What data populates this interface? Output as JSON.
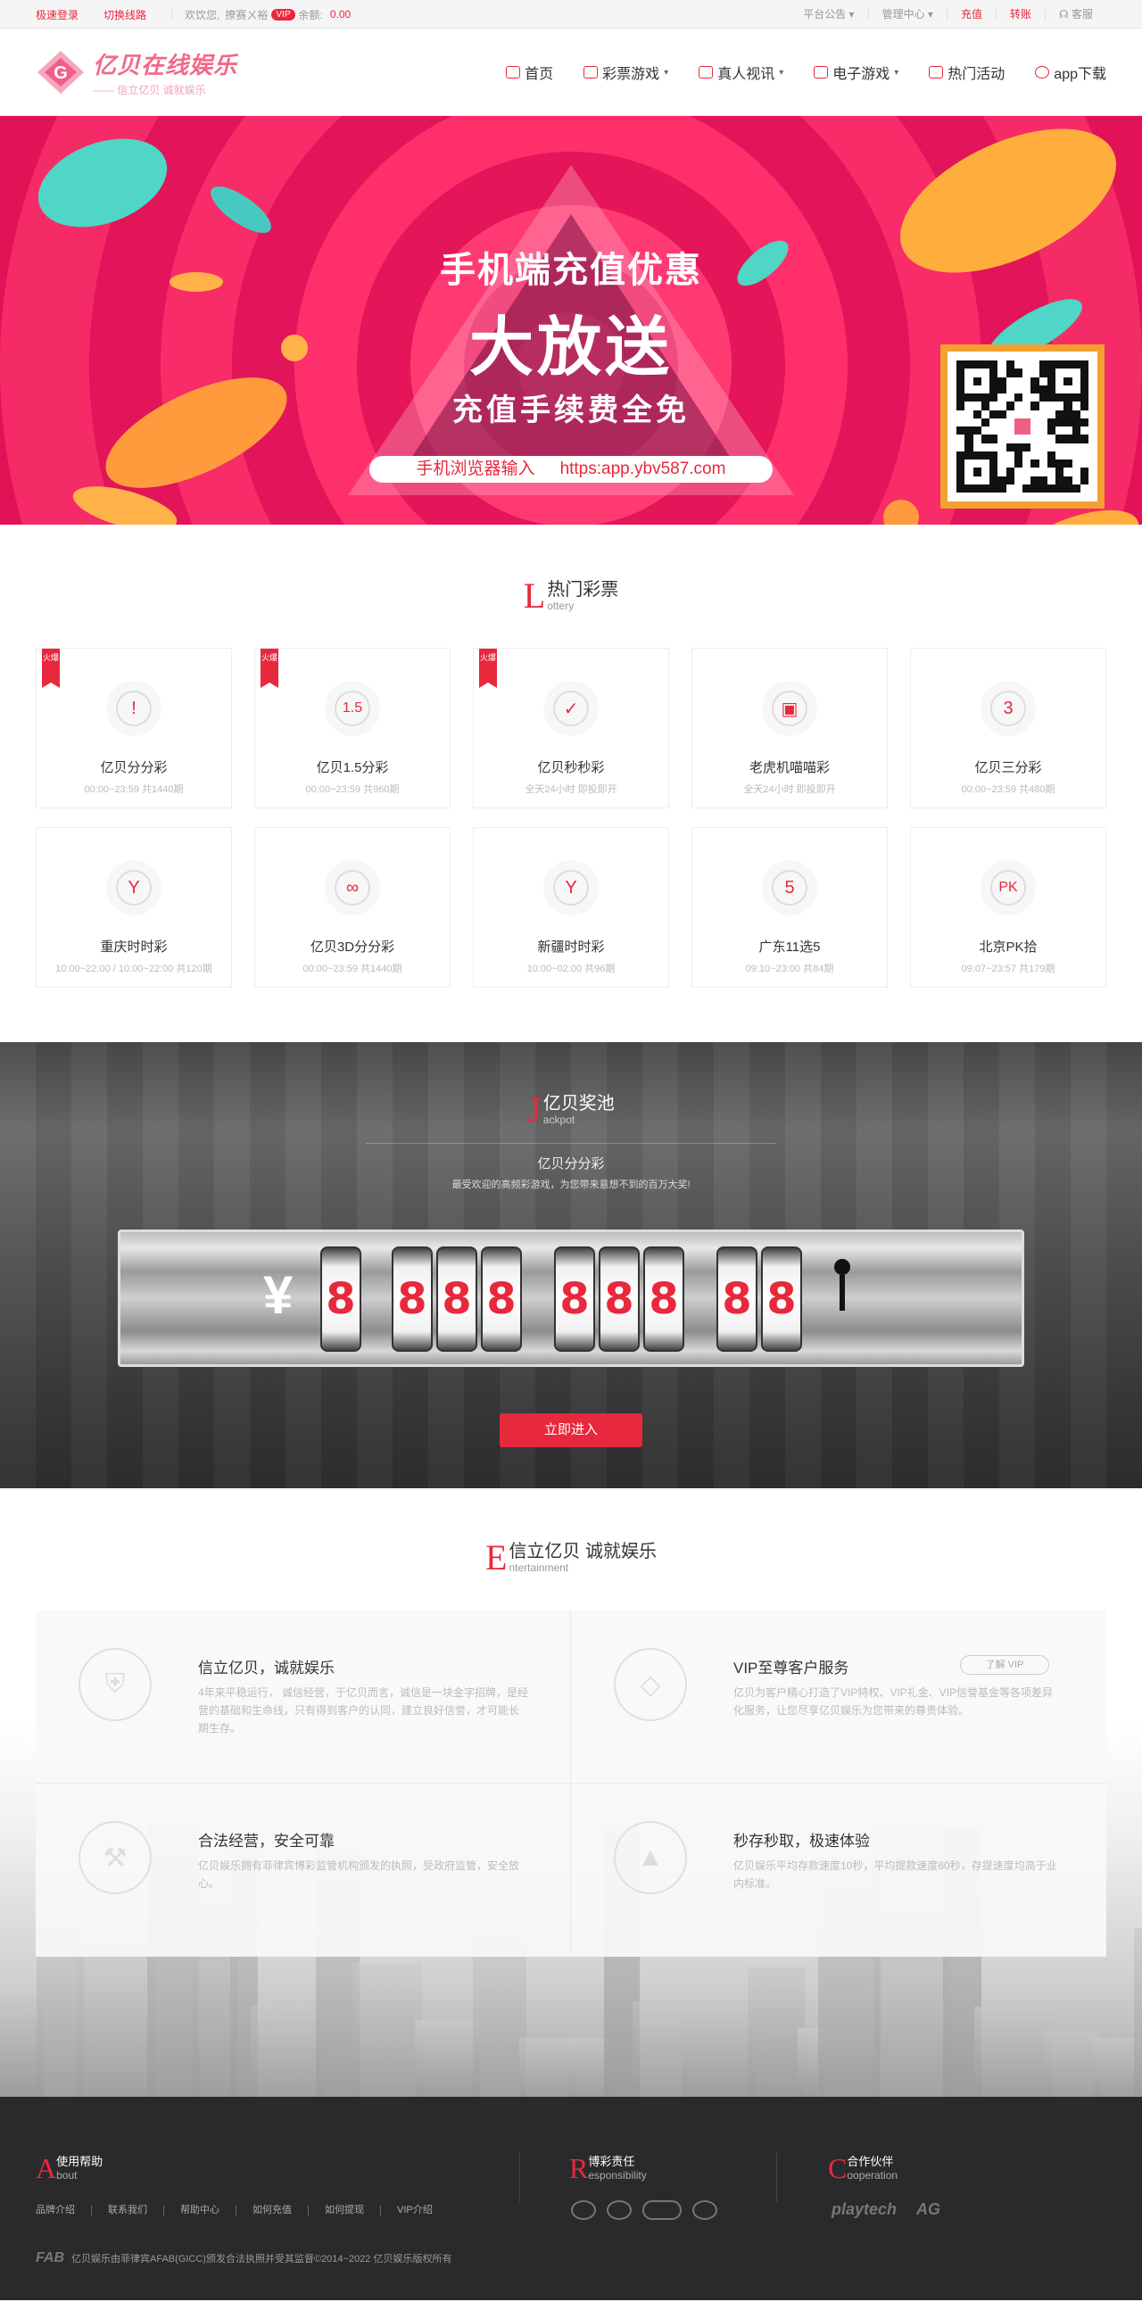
{
  "topbar": {
    "quick_login": "极速登录",
    "switch_line": "切换线路",
    "welcome": "欢饮您,",
    "username": "撩赛ㄨ裕",
    "vip_badge": "VIP",
    "balance_label": "余额:",
    "balance_value": "0.00",
    "platform_notice": "平台公告",
    "manage_center": "管理中心",
    "recharge": "充值",
    "transfer": "转账",
    "service": "客服"
  },
  "header": {
    "logo_title": "亿贝在线娱乐",
    "logo_slogan": "—— 信立亿贝  诚就娱乐",
    "nav": [
      {
        "label": "首页",
        "icon": "home-icon",
        "caret": ""
      },
      {
        "label": "彩票游戏",
        "icon": "lottery-icon",
        "caret": "▾"
      },
      {
        "label": "真人视讯",
        "icon": "live-video-icon",
        "caret": "▾"
      },
      {
        "label": "电子游戏",
        "icon": "gamepad-icon",
        "caret": "▾"
      },
      {
        "label": "热门活动",
        "icon": "activity-icon",
        "caret": ""
      },
      {
        "label": "app下载",
        "icon": "app-download-icon",
        "caret": ""
      }
    ]
  },
  "banner": {
    "line1": "手机端充值优惠",
    "line2": "大放送",
    "line3": "充值手续费全免",
    "url_label": "手机浏览器输入",
    "url": "https:app.ybv587.com",
    "slides": 3,
    "active_slide": 1
  },
  "lottery": {
    "title_letter": "L",
    "title_cn": "热门彩票",
    "title_en": "ottery",
    "hot_label": "火爆",
    "items": [
      {
        "name": "亿贝分分彩",
        "desc": "00:00~23:59 共1440期",
        "hot": true,
        "glyph": "!"
      },
      {
        "name": "亿贝1.5分彩",
        "desc": "00:00~23:59 共960期",
        "hot": true,
        "glyph": "1.5"
      },
      {
        "name": "亿贝秒秒彩",
        "desc": "全天24小时 即投即开",
        "hot": true,
        "glyph": "✓"
      },
      {
        "name": "老虎机喵喵彩",
        "desc": "全天24小时 即投即开",
        "hot": false,
        "glyph": "▣"
      },
      {
        "name": "亿贝三分彩",
        "desc": "00:00~23:59 共480期",
        "hot": false,
        "glyph": "3"
      },
      {
        "name": "重庆时时彩",
        "desc": "10:00~22:00 / 10:00~22:00 共120期",
        "hot": false,
        "glyph": "Y"
      },
      {
        "name": "亿贝3D分分彩",
        "desc": "00:00~23:59 共1440期",
        "hot": false,
        "glyph": "∞"
      },
      {
        "name": "新疆时时彩",
        "desc": "10:00~02:00 共96期",
        "hot": false,
        "glyph": "Y"
      },
      {
        "name": "广东11选5",
        "desc": "09:10~23:00 共84期",
        "hot": false,
        "glyph": "5"
      },
      {
        "name": "北京PK拾",
        "desc": "09:07~23:57 共179期",
        "hot": false,
        "glyph": "PK"
      }
    ]
  },
  "jackpot": {
    "title_letter": "J",
    "title_cn": "亿贝奖池",
    "title_en": "ackpot",
    "game": "亿贝分分彩",
    "subtitle": "最受欢迎的高频彩游戏，为您带来意想不到的百万大奖!",
    "currency": "¥",
    "digits": [
      "8",
      "8",
      "8",
      "8",
      "8",
      "8",
      "8",
      "8",
      "8",
      "8"
    ],
    "enter_button": "立即进入"
  },
  "entertainment": {
    "title_letter": "E",
    "title_cn": "信立亿贝   诚就娱乐",
    "title_en": "ntertainment",
    "features": [
      {
        "title": "信立亿贝，诚就娱乐",
        "text": "4年来平稳运行， 诚信经营，于亿贝而言，诚信是一块金字招牌，是经营的基础和生命线，只有得到客户的认同，建立良好信誉，才可能长期生存。",
        "icon": "shield-icon"
      },
      {
        "title": "VIP至尊客户服务",
        "text": "亿贝为客户精心打造了VIP特权、VIP礼金、VIP信誉基金等各项差异化服务，让您尽享亿贝娱乐为您带来的尊贵体验。",
        "icon": "diamond-icon",
        "more": "了解 VIP"
      },
      {
        "title": "合法经营，安全可靠",
        "text": "亿贝娱乐拥有菲律宾博彩监管机构颁发的执照，受政府监管，安全放心。",
        "icon": "gavel-icon"
      },
      {
        "title": "秒存秒取，极速体验",
        "text": "亿贝娱乐平均存款速度10秒，平均提款速度60秒，存提速度均高于业内标准。",
        "icon": "rocket-icon"
      }
    ]
  },
  "footer": {
    "help_letter": "A",
    "help_cn": "使用帮助",
    "help_en": "bout",
    "resp_letter": "R",
    "resp_cn": "博彩责任",
    "resp_en": "esponsibility",
    "coop_letter": "C",
    "coop_cn": "合作伙伴",
    "coop_en": "ooperation",
    "links": [
      "品牌介绍",
      "联系我们",
      "帮助中心",
      "如何充值",
      "如何提现",
      "VIP介绍"
    ],
    "partners": [
      "playtech",
      "AG"
    ],
    "fab": "FAB",
    "copyright": "亿贝娱乐由菲律宾AFAB(GICC)颁发合法执照并受其监督©2014~2022 亿贝娱乐版权所有"
  }
}
